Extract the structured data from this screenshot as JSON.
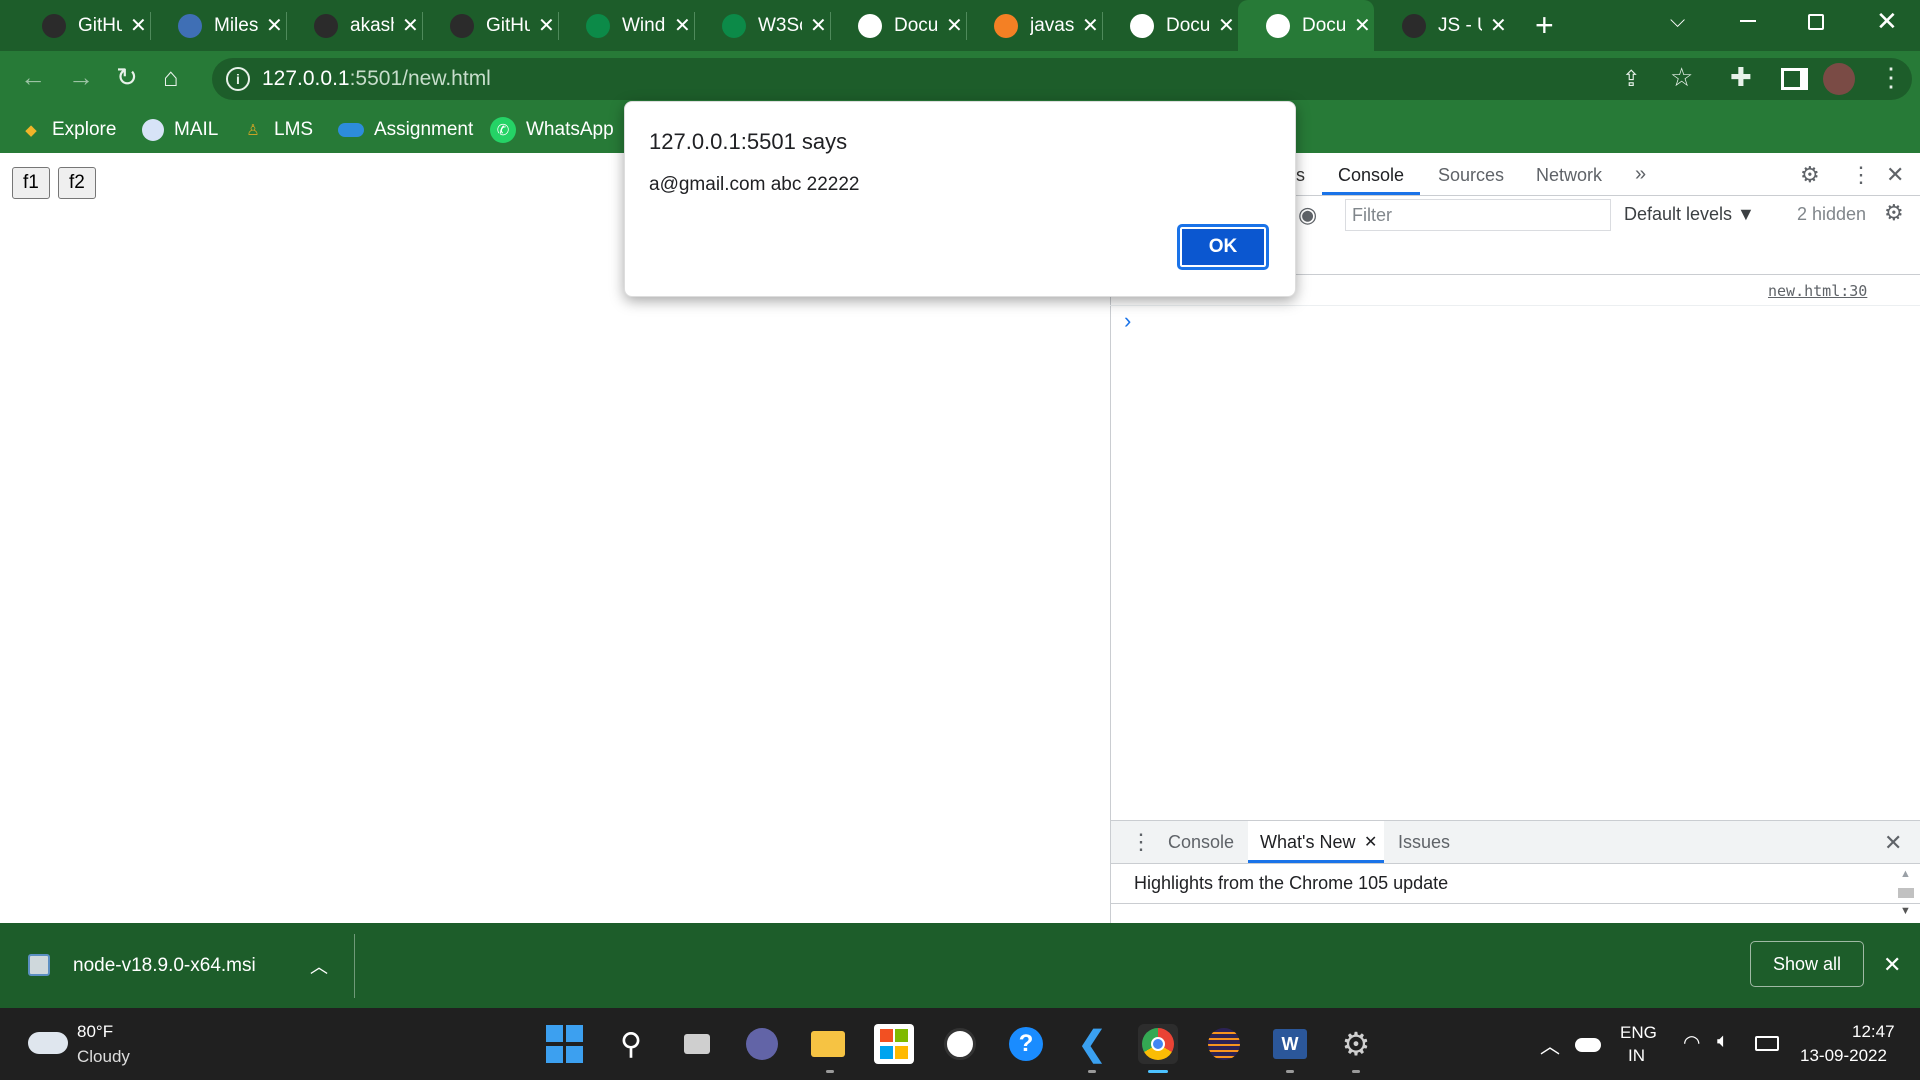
{
  "tabs": [
    {
      "label": "GitHu",
      "icon": "github-icon",
      "color": "#2b2b2b"
    },
    {
      "label": "Miles",
      "icon": "milestone-icon",
      "color": "#3f6fb5"
    },
    {
      "label": "akash",
      "icon": "github-icon",
      "color": "#2b2b2b"
    },
    {
      "label": "GitHu",
      "icon": "github-icon",
      "color": "#2b2b2b"
    },
    {
      "label": "Wind",
      "icon": "w3-icon",
      "color": "#0c8a48"
    },
    {
      "label": "W3Sc",
      "icon": "w3-icon",
      "color": "#0c8a48"
    },
    {
      "label": "Docu",
      "icon": "globe-icon",
      "color": "#ffffff"
    },
    {
      "label": "javas",
      "icon": "stackoverflow-icon",
      "color": "#f48024"
    },
    {
      "label": "Docu",
      "icon": "globe-icon",
      "color": "#ffffff"
    },
    {
      "label": "Docu",
      "icon": "globe-icon",
      "color": "#ffffff"
    },
    {
      "label": "JS - U",
      "icon": "github-icon",
      "color": "#2b2b2b"
    }
  ],
  "address": {
    "host": "127.0.0.1",
    "rest": ":5501/new.html"
  },
  "bookmarks": [
    "Explore",
    "MAIL",
    "LMS",
    "Assignment",
    "WhatsApp"
  ],
  "page": {
    "buttons": [
      "f1",
      "f2"
    ]
  },
  "alert": {
    "title": "127.0.0.1:5501 says",
    "message": "a@gmail.com abc 22222",
    "ok_label": "OK"
  },
  "devtools": {
    "tab_partial": "s",
    "tabs": [
      "Console",
      "Sources",
      "Network"
    ],
    "filter_placeholder": "Filter",
    "levels": "Default levels ▼",
    "hidden": "2 hidden",
    "log_source": "new.html:30",
    "prompt": "›",
    "drawer_tabs": [
      "Console",
      "What's New",
      "Issues"
    ],
    "drawer_text": "Highlights from the Chrome 105 update"
  },
  "download": {
    "file": "node-v18.9.0-x64.msi",
    "show_all": "Show all"
  },
  "taskbar": {
    "weather_temp": "80°F",
    "weather_desc": "Cloudy",
    "lang_top": "ENG",
    "lang_bottom": "IN",
    "time": "12:47",
    "date": "13-09-2022"
  },
  "colors": {
    "chrome_dark": "#1d5d2a",
    "chrome": "#277a37",
    "dialog_button": "#0b57d0",
    "devtools_blue": "#1a73e8"
  }
}
